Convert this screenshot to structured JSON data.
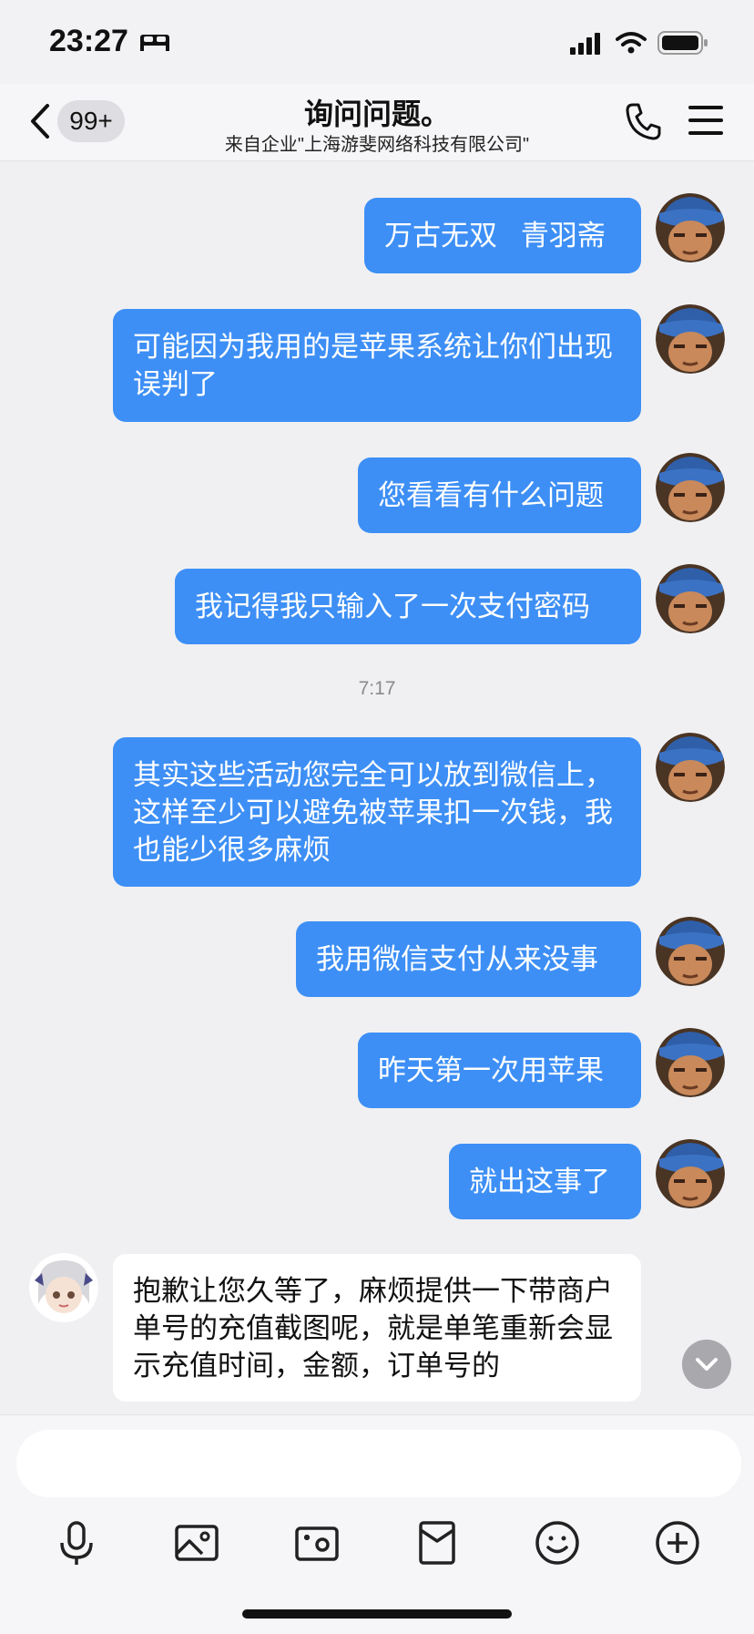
{
  "status_bar": {
    "time": "23:27"
  },
  "header": {
    "unread_count": "99+",
    "title": "询问问题。",
    "subtitle": "来自企业\"上海游斐网络科技有限公司\""
  },
  "messages": [
    {
      "text": "万古无双   青羽斋"
    },
    {
      "text": "可能因为我用的是苹果系统让你们出现误判了"
    },
    {
      "text": "您看看有什么问题"
    },
    {
      "text": "我记得我只输入了一次支付密码"
    },
    {
      "timestamp": "7:17"
    },
    {
      "text": "其实这些活动您完全可以放到微信上，这样至少可以避免被苹果扣一次钱，我也能少很多麻烦"
    },
    {
      "text": "我用微信支付从来没事"
    },
    {
      "text": "昨天第一次用苹果"
    },
    {
      "text": "就出这事了"
    },
    {
      "text": "抱歉让您久等了，麻烦提供一下带商户单号的充值截图呢，就是单笔重新会显示充值时间，金额，订单号的"
    }
  ],
  "colors": {
    "outgoing_bubble": "#3d8ff5",
    "incoming_bubble": "#ffffff",
    "background": "#f0f0f2"
  },
  "toolbar": {
    "icons": [
      "microphone-icon",
      "image-icon",
      "camera-icon",
      "red-packet-icon",
      "emoji-icon",
      "plus-icon"
    ]
  }
}
